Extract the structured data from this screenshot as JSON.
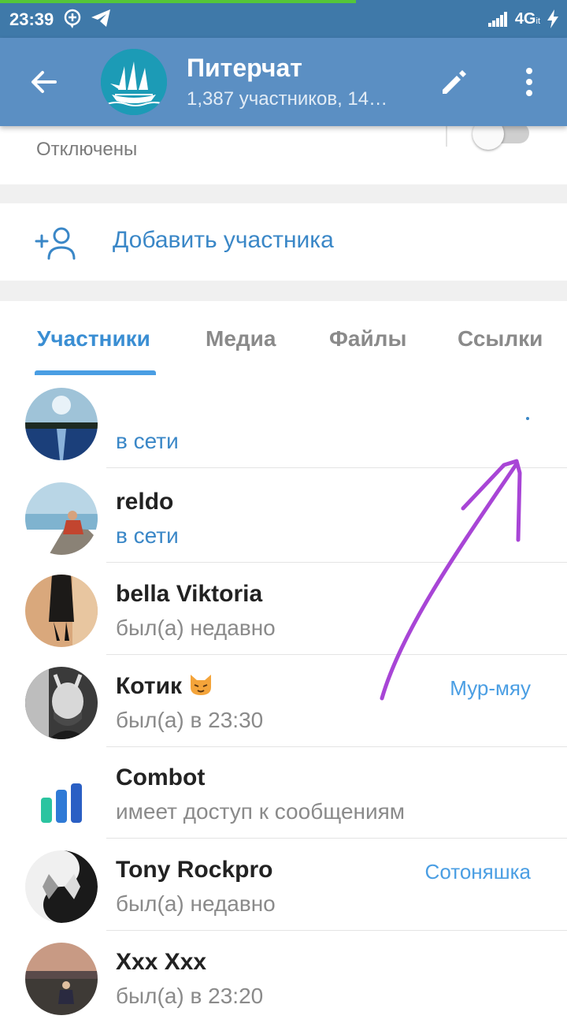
{
  "status_bar": {
    "time": "23:39",
    "network": "4G",
    "network_sub": "it",
    "icons": [
      "add-circle-icon",
      "telegram-plane-icon",
      "signal-icon",
      "charging-icon"
    ]
  },
  "header": {
    "title": "Питерчат",
    "subtitle": "1,387 участников, 14…",
    "icons": [
      "back-arrow-icon",
      "edit-pencil-icon",
      "more-vertical-icon"
    ]
  },
  "notifications": {
    "value": "Отключены",
    "toggle_on": false
  },
  "add_member": {
    "label": "Добавить участника"
  },
  "tabs": [
    {
      "label": "Участники",
      "active": true
    },
    {
      "label": "Медиа",
      "active": false
    },
    {
      "label": "Файлы",
      "active": false
    },
    {
      "label": "Ссылки",
      "active": false
    }
  ],
  "members": [
    {
      "name": "",
      "status": "в сети",
      "online": true,
      "badge": ""
    },
    {
      "name": "reldo",
      "status": "в сети",
      "online": true,
      "badge": ""
    },
    {
      "name": "bella Viktoria",
      "status": "был(а) недавно",
      "online": false,
      "badge": ""
    },
    {
      "name": "Котик",
      "status": "был(а) в 23:30",
      "online": false,
      "badge": "Мур-мяу"
    },
    {
      "name": "Combot",
      "status": "имеет доступ к сообщениям",
      "online": false,
      "badge": ""
    },
    {
      "name": "Tony Rockpro",
      "status": "был(а) недавно",
      "online": false,
      "badge": "Сотоняшка"
    },
    {
      "name": "Xxx Xxx",
      "status": "был(а) в 23:20",
      "online": false,
      "badge": ""
    }
  ],
  "colors": {
    "app_bar": "#5b8fc3",
    "status_bar": "#3f79a9",
    "accent": "#3a87c7",
    "annotation_arrow": "#a845d6"
  }
}
